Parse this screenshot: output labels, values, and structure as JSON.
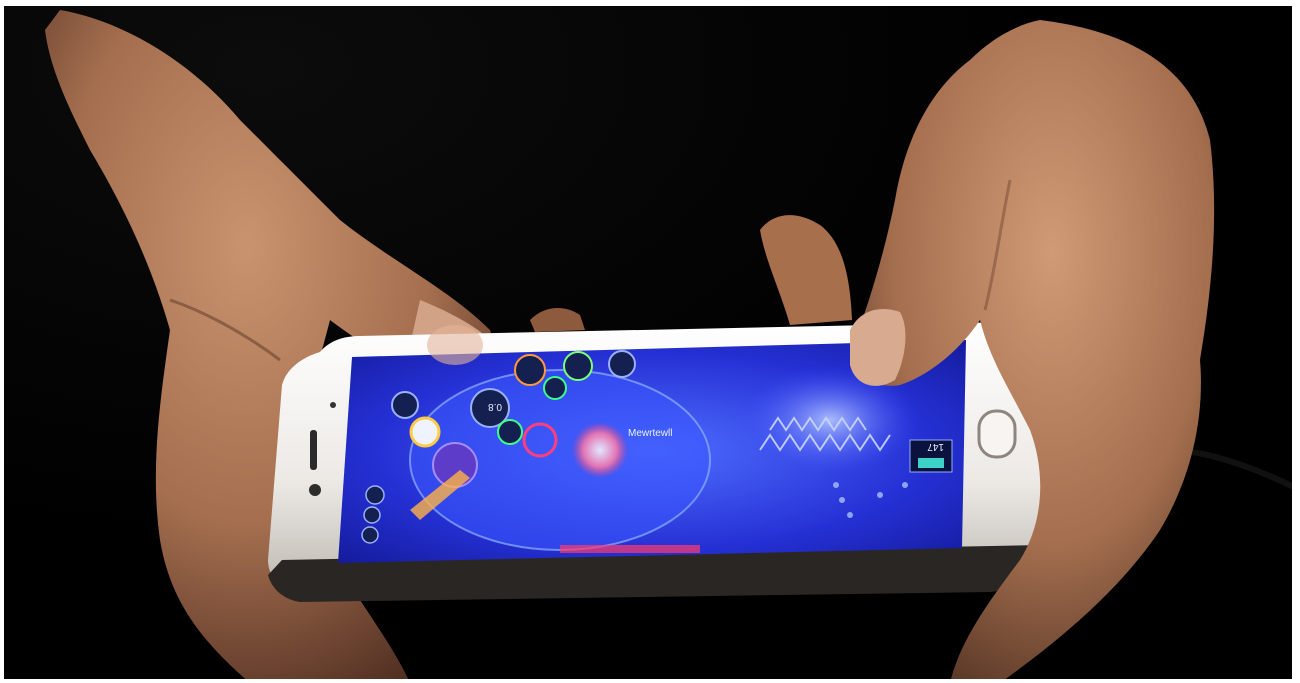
{
  "photo": {
    "subject": "hands-holding-phone-playing-moba-game",
    "colors": {
      "background": "#000000",
      "skin": "#b7815f",
      "skin_shadow": "#6b4230",
      "phone_body": "#f3f1ee",
      "screen_base": "#1f2bd8",
      "screen_glow": "#6f8dff"
    }
  },
  "game_hud": {
    "ability_value": "0.8",
    "player_name": "Mewrtewll",
    "score": "147"
  }
}
